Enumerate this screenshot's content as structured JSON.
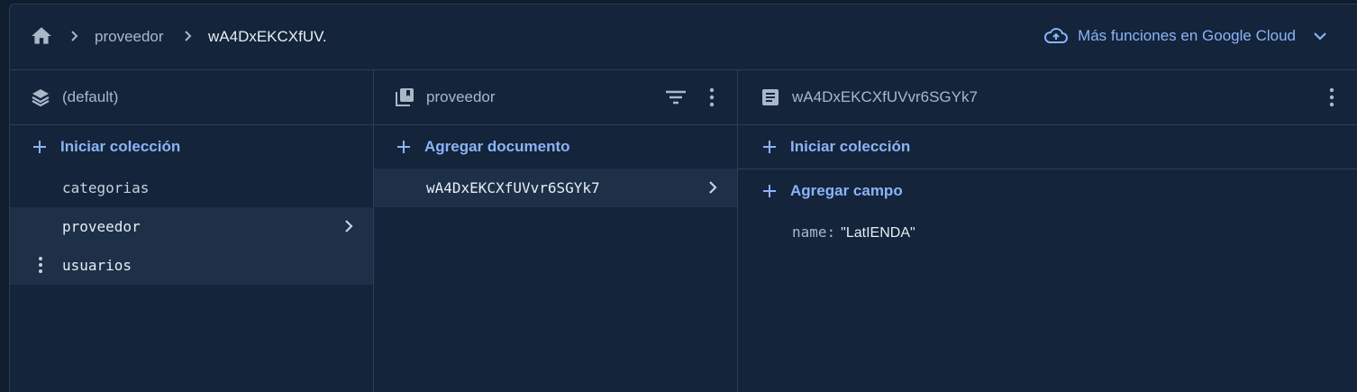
{
  "topbar": {
    "breadcrumb": [
      "proveedor",
      "wA4DxEKCXfUV."
    ],
    "cloud_link": "Más funciones en Google Cloud"
  },
  "panel_database": {
    "title": "(default)",
    "add_label": "Iniciar colección",
    "collections": [
      "categorias",
      "proveedor",
      "usuarios"
    ],
    "selected": "proveedor"
  },
  "panel_collection": {
    "title": "proveedor",
    "add_label": "Agregar documento",
    "documents": [
      "wA4DxEKCXfUVvr6SGYk7"
    ]
  },
  "panel_document": {
    "title": "wA4DxEKCXfUVvr6SGYk7",
    "add_collection_label": "Iniciar colección",
    "add_field_label": "Agregar campo",
    "fields": [
      {
        "key": "name:",
        "value": "\"LatIENDA\""
      }
    ]
  },
  "colors": {
    "accent": "#8ab4f8",
    "background": "#14243a",
    "selected_row": "#1d3047",
    "border": "#2c3f55"
  },
  "icons": {
    "home": "home-icon",
    "database": "layers-icon",
    "collection": "collection-icon",
    "document": "document-icon",
    "cloud": "cloud-icon",
    "filter": "filter-icon",
    "more": "more-vert-icon"
  }
}
